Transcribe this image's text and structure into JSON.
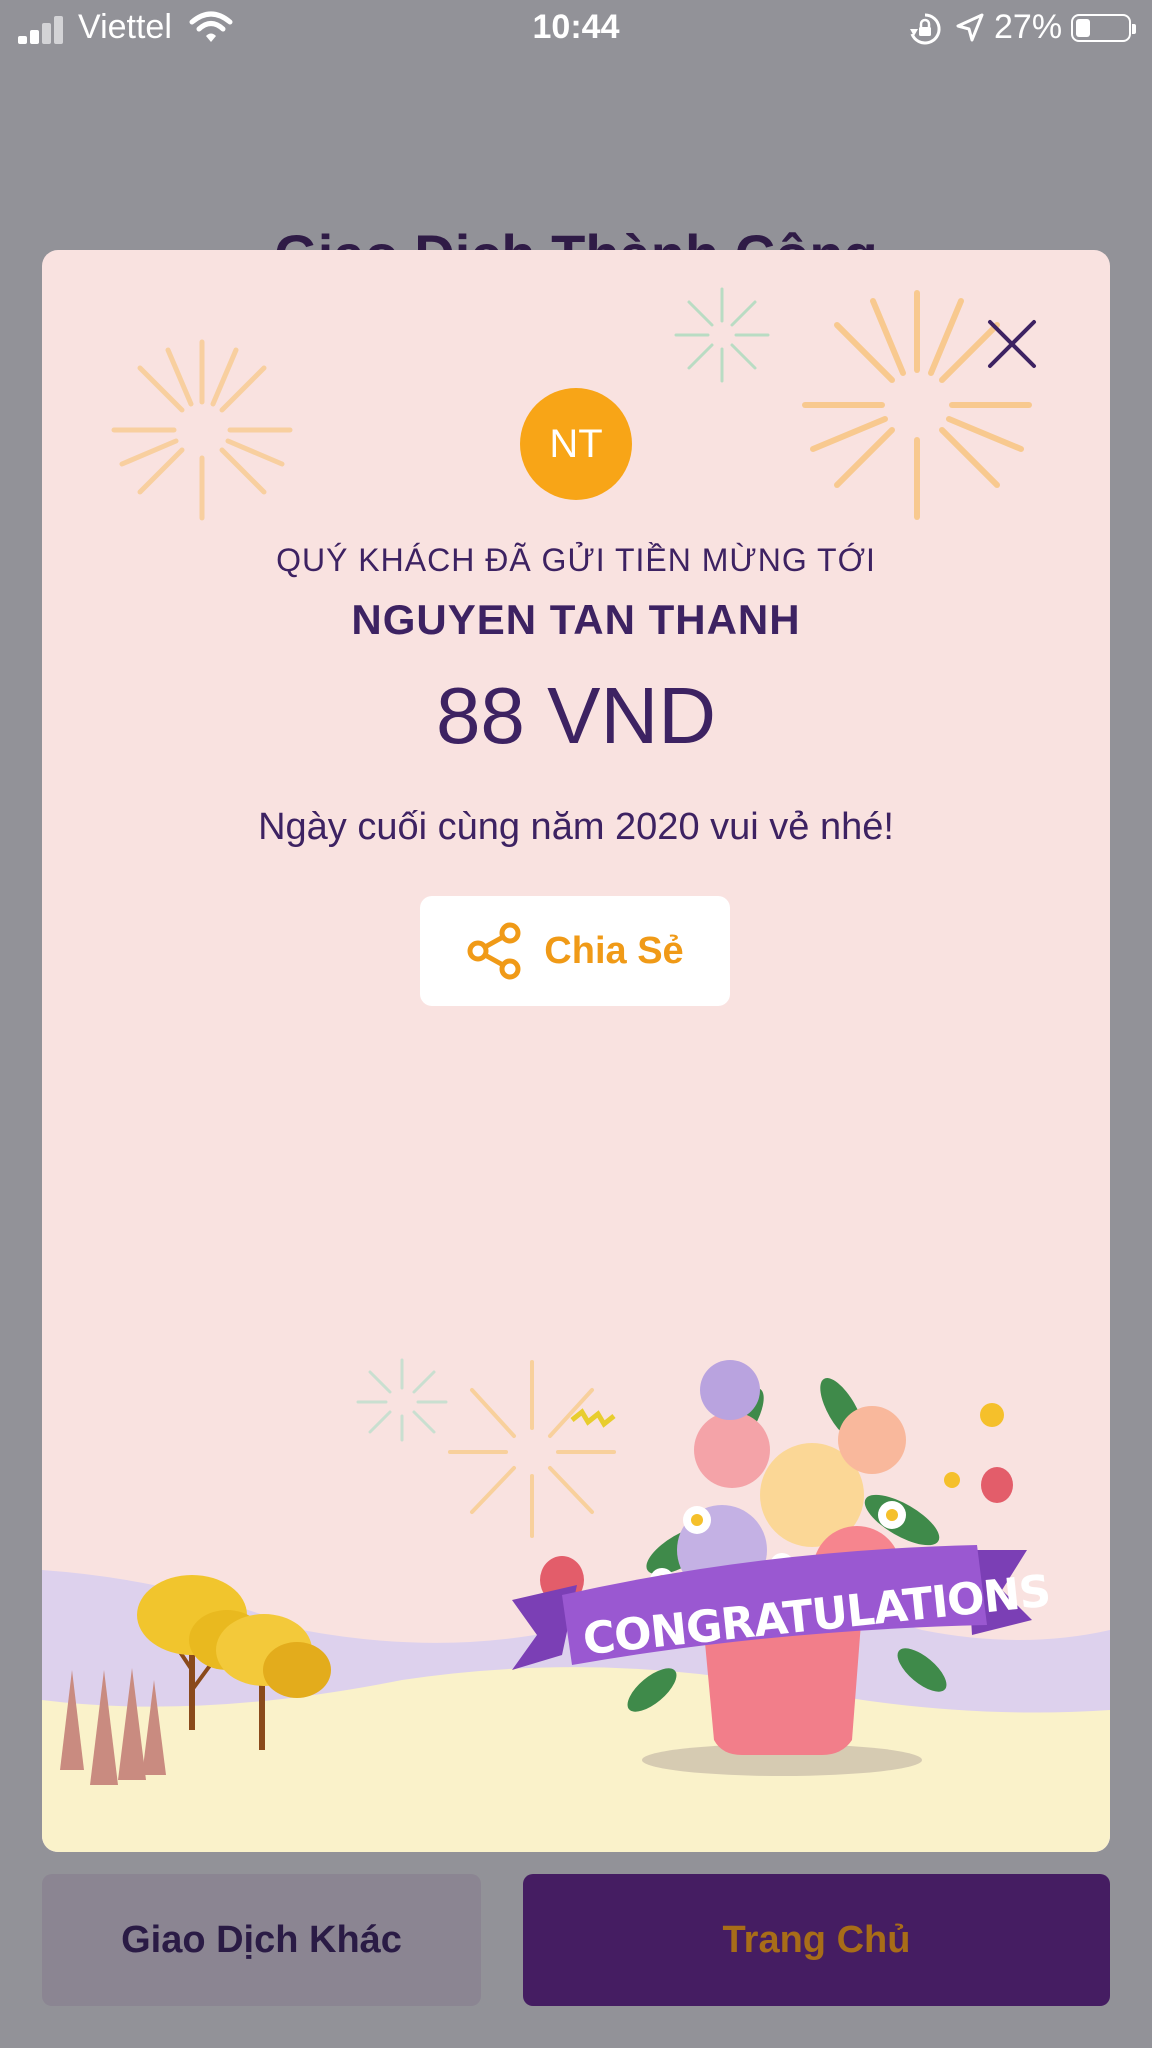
{
  "status_bar": {
    "carrier": "Viettel",
    "time": "10:44",
    "battery": "27%",
    "battery_level": 0.27
  },
  "background": {
    "title": "Giao Dịch Thành Công"
  },
  "modal": {
    "avatar_initials": "NT",
    "sent_label": "QUÝ KHÁCH ĐÃ GỬI TIỀN MỪNG TỚI",
    "recipient_name": "NGUYEN TAN THANH",
    "amount": "88 VND",
    "message": "Ngày cuối cùng năm 2020 vui vẻ nhé!",
    "share_label": "Chia Sẻ",
    "banner_text": "CONGRATULATIONS"
  },
  "footer": {
    "other_transaction_label": "Giao Dịch Khác",
    "home_label": "Trang Chủ"
  },
  "colors": {
    "accent_purple": "#3d2262",
    "avatar_orange": "#f8a517",
    "share_orange": "#f09a17",
    "home_button": "#451d62"
  }
}
